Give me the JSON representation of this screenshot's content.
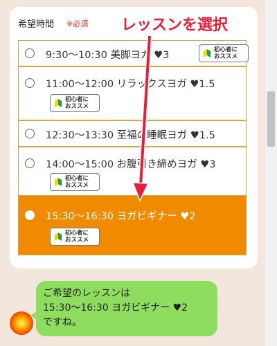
{
  "form": {
    "label": "希望時間",
    "required": "※必須"
  },
  "annotation": {
    "text": "レッスンを選択",
    "color": "#e91e37"
  },
  "badge": {
    "line1": "初心者に",
    "line2": "おススメ"
  },
  "options": [
    {
      "label": "9:30～10:30 美脚ヨガ ♥3",
      "selected": false,
      "badge": true
    },
    {
      "label": "11:00～12:00 リラックスヨガ ♥1.5",
      "selected": false,
      "badge": true
    },
    {
      "label": "12:30～13:30 至福の睡眠ヨガ ♥1.5",
      "selected": false,
      "badge": false
    },
    {
      "label": "14:00～15:00 お腹引き締めヨガ ♥3",
      "selected": false,
      "badge": true
    },
    {
      "label": "15:30～16:30 ヨガビギナー ♥2",
      "selected": true,
      "badge": true
    }
  ],
  "chat": {
    "line1": "ご希望のレッスンは",
    "line2": "15:30～16:30 ヨガビギナー ♥2",
    "line3": "ですね。"
  },
  "colors": {
    "selected_bg": "#f08b00",
    "option_border": "#d8a64a",
    "bubble": "#8fdd5e",
    "page_bg": "#f3e6dc"
  }
}
